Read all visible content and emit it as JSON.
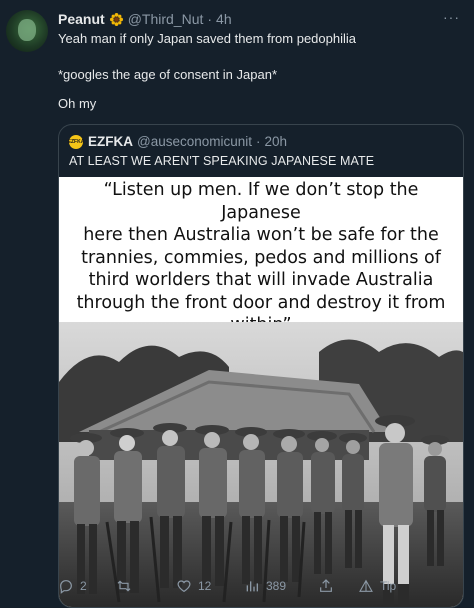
{
  "tweet": {
    "author_name": "Peanut",
    "author_handle": "@Third_Nut",
    "separator": "·",
    "time": "4h",
    "more_label": "···",
    "lines": [
      "Yeah man if only Japan saved them from pedophilia",
      "*googles the age of consent in Japan*",
      "Oh my"
    ]
  },
  "quoted_tweet": {
    "author_name": "EZFKA",
    "avatar_text": "EZFKA",
    "author_handle": "@auseconomicunit",
    "separator": "·",
    "time": "20h",
    "text": "AT LEAST WE AREN'T SPEAKING JAPANESE MATE",
    "image_caption_lines": [
      "“Listen up men. If we don’t stop the Japanese",
      "here then Australia won’t be safe for the",
      "trannies, commies, pedos and millions of",
      "third worlders that will invade Australia",
      "through the front door and destroy it from",
      "within”"
    ]
  },
  "actions": {
    "replies": "2",
    "likes": "12",
    "views": "389",
    "tip_label": "Tip"
  },
  "colors": {
    "background": "#15202b",
    "text": "#e7e9ea",
    "muted": "#8b98a5",
    "border": "#38444d"
  },
  "icons": [
    "reply-icon",
    "retweet-icon",
    "like-icon",
    "views-icon",
    "share-icon",
    "tip-icon",
    "sunflower-badge-icon"
  ]
}
